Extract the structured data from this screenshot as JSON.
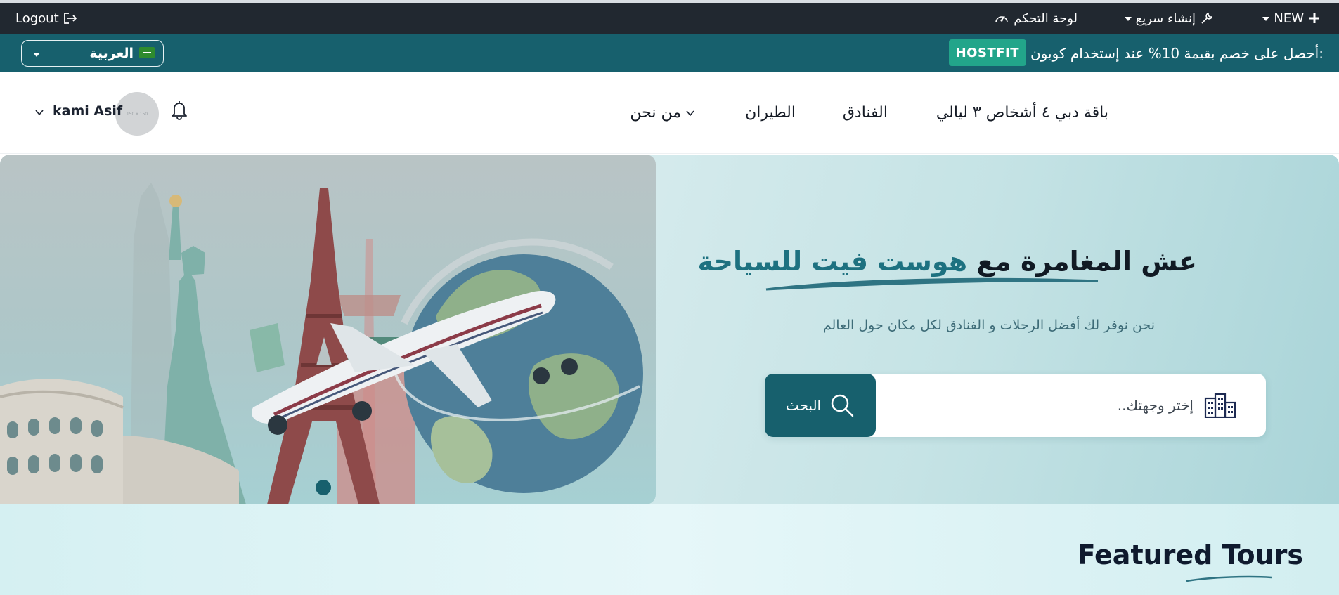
{
  "admin_bar": {
    "logout": "Logout",
    "dashboard": "لوحة التحكم",
    "quick_create": "إنشاء سريع",
    "new": "NEW"
  },
  "promo": {
    "text": "أحصل على خصم بقيمة 10% عند إستخدام كوبون:",
    "coupon": "HOSTFIT",
    "language": "العربية"
  },
  "nav": {
    "dubai_package": "باقة دبي ٤ أشخاص ٣ ليالي",
    "hotels": "الفنادق",
    "flights": "الطيران",
    "about": "من نحن"
  },
  "user": {
    "name": "kami Asif",
    "avatar_placeholder": "150 x 150"
  },
  "hero": {
    "title_part1": "عش المغامرة مع",
    "title_accent": "هوست فيت للسياحة",
    "subtitle": "نحن نوفر لك أفضل الرحلات و الفنادق لكل مكان حول العالم",
    "search_placeholder": "إختر وجهتك..",
    "search_button": "البحث"
  },
  "featured": {
    "title": "Featured Tours"
  },
  "colors": {
    "admin_bar": "#212830",
    "primary_teal": "#17606d",
    "coupon_green": "#22a58a",
    "accent_text": "#1d7180"
  }
}
